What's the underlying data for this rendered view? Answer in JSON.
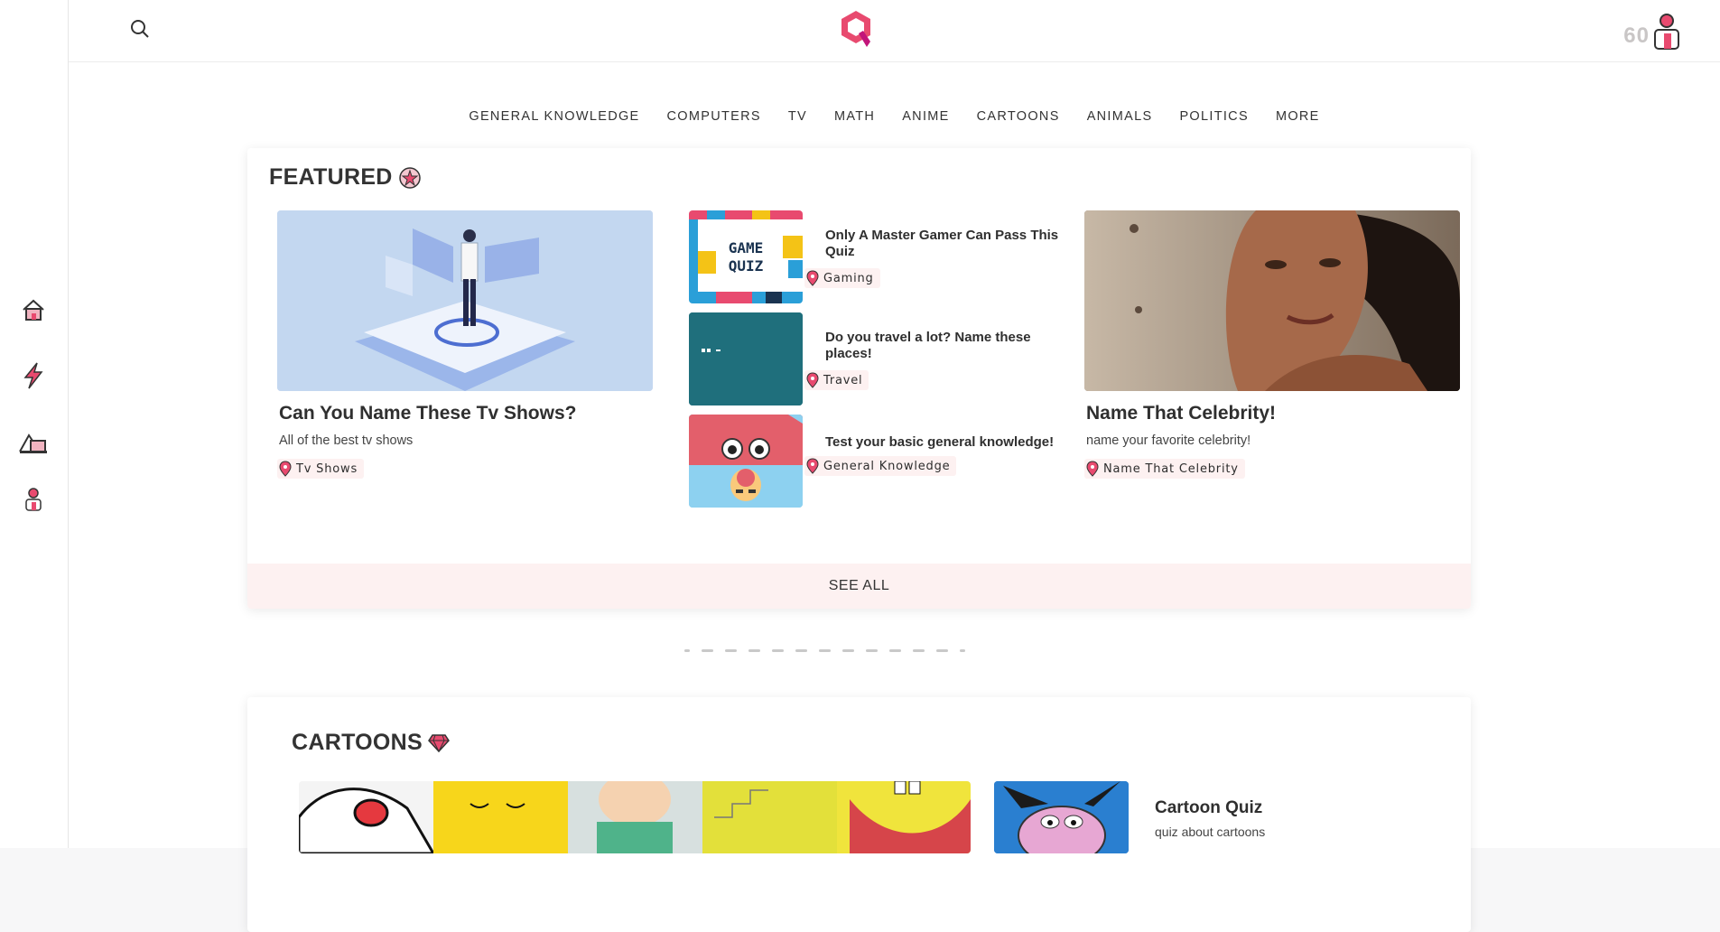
{
  "header": {
    "score": "60"
  },
  "nav": {
    "items": [
      "GENERAL KNOWLEDGE",
      "COMPUTERS",
      "TV",
      "MATH",
      "ANIME",
      "CARTOONS",
      "ANIMALS",
      "POLITICS",
      "MORE"
    ]
  },
  "featured": {
    "title": "FEATURED",
    "left": {
      "title": "Can You Name These Tv Shows?",
      "desc": "All of the best tv shows",
      "tag": "Tv Shows"
    },
    "middle": [
      {
        "title": "Only A Master Gamer Can Pass This Quiz",
        "tag": "Gaming",
        "image_text": [
          "GAME",
          "QUIZ"
        ]
      },
      {
        "title": "Do you travel a lot? Name these places!",
        "tag": "Travel"
      },
      {
        "title": "Test your basic general knowledge!",
        "tag": "General Knowledge"
      }
    ],
    "right": {
      "title": "Name That Celebrity!",
      "desc": "name your favorite celebrity!",
      "tag": "Name That Celebrity"
    },
    "see_all": "SEE ALL"
  },
  "carousel": {
    "dots": 13,
    "active": 0
  },
  "cartoons": {
    "title": "CARTOONS",
    "side": {
      "title": "Cartoon Quiz",
      "desc": "quiz about cartoons"
    }
  },
  "colors": {
    "accent": "#e84a6f",
    "tag_bg": "#fdf1f1",
    "see_all_bg": "#fdf1f1"
  },
  "icons": [
    "search-icon",
    "logo-icon",
    "home-icon",
    "lightning-icon",
    "trophy-icon",
    "profile-icon",
    "star-badge-icon",
    "gem-icon",
    "pin-icon"
  ]
}
